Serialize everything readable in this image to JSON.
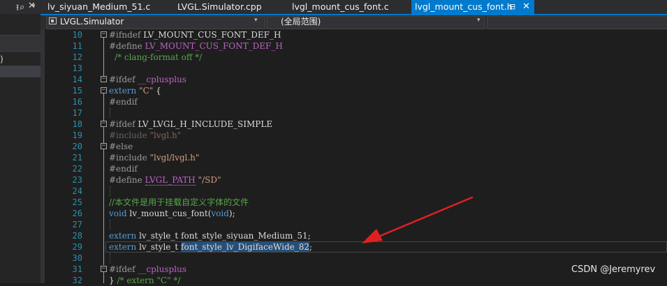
{
  "left_panel": {
    "pin_glyph": "⭱",
    "close_glyph": "✕",
    "search_glyph": "⌕",
    "search_dropdown_glyph": "▾",
    "text_fragment": ")"
  },
  "tabs": [
    {
      "label": "lv_siyuan_Medium_51.c"
    },
    {
      "label": "LVGL.Simulator.cpp"
    },
    {
      "label": "lvgl_mount_cus_font.c"
    },
    {
      "label": "lvgl_mount_cus_font.h",
      "active": true
    }
  ],
  "active_tab": {
    "label": "lvgl_mount_cus_font.h",
    "pin_glyph": "⊟",
    "close_glyph": "✕"
  },
  "navbar": {
    "project": "LVGL.Simulator",
    "scope": "(全局范围)",
    "arrow_glyph": "▾"
  },
  "editor": {
    "lines": [
      {
        "n": "10",
        "text": "#ifndef LV_MOUNT_CUS_FONT_DEF_H"
      },
      {
        "n": "11",
        "text": "#define LV_MOUNT_CUS_FONT_DEF_H"
      },
      {
        "n": "12",
        "text": "/* clang-format off */"
      },
      {
        "n": "13",
        "text": ""
      },
      {
        "n": "14",
        "text": "#ifdef __cplusplus"
      },
      {
        "n": "15",
        "text": "extern \"C\" {"
      },
      {
        "n": "16",
        "text": "#endif"
      },
      {
        "n": "17",
        "text": ""
      },
      {
        "n": "18",
        "text": "#ifdef LV_LVGL_H_INCLUDE_SIMPLE"
      },
      {
        "n": "19",
        "text": "#include \"lvgl.h\""
      },
      {
        "n": "20",
        "text": "#else"
      },
      {
        "n": "21",
        "text": "#include \"lvgl/lvgl.h\""
      },
      {
        "n": "22",
        "text": "#endif"
      },
      {
        "n": "23",
        "text": "#define LVGL_PATH \"/SD\""
      },
      {
        "n": "24",
        "text": ""
      },
      {
        "n": "25",
        "text": "//本文件是用于挂载自定义字体的文件"
      },
      {
        "n": "26",
        "text": "void lv_mount_cus_font(void);"
      },
      {
        "n": "27",
        "text": ""
      },
      {
        "n": "28",
        "text": "extern lv_style_t font_style_siyuan_Medium_51;"
      },
      {
        "n": "29",
        "text": "extern lv_style_t font_style_lv_DigifaceWide_82;"
      },
      {
        "n": "30",
        "text": ""
      },
      {
        "n": "31",
        "text": "#ifdef __cplusplus"
      },
      {
        "n": "32",
        "text": "} /* extern \"C\" */"
      }
    ],
    "tokens": {
      "ifndef": "#ifndef",
      "define": "#define",
      "ifdef": "#ifdef",
      "endif": "#endif",
      "else": "#else",
      "include": "#include",
      "guard_macro": "LV_MOUNT_CUS_FONT_DEF_H",
      "clang_comment": "/* clang-format off */",
      "cplusplus": "__cplusplus",
      "extern": "extern",
      "c_str": "\"C\"",
      "brace_open": "{",
      "brace_close": "}",
      "simple_macro": "LV_LVGL_H_INCLUDE_SIMPLE",
      "lvgl_h": "\"lvgl.h\"",
      "lvgl_lvgl_h": "\"lvgl/lvgl.h\"",
      "path_macro": "LVGL_PATH",
      "sd_str": "\"/SD\"",
      "cn_comment": "//本文件是用于挂载自定义字体的文件",
      "void": "void",
      "mount_fn": "lv_mount_cus_font",
      "paren_void_open": "(",
      "paren_void_close": ");",
      "style_t": "lv_style_t",
      "font1": "font_style_siyuan_Medium_51",
      "font2": "font_style_lv_DigifaceWide_82",
      "semi": ";",
      "extern_c_comment": "/* extern \"C\" */"
    }
  },
  "watermark": "CSDN @Jeremyrev",
  "colors": {
    "accent": "#007acc",
    "annotation_arrow": "#e02020"
  }
}
